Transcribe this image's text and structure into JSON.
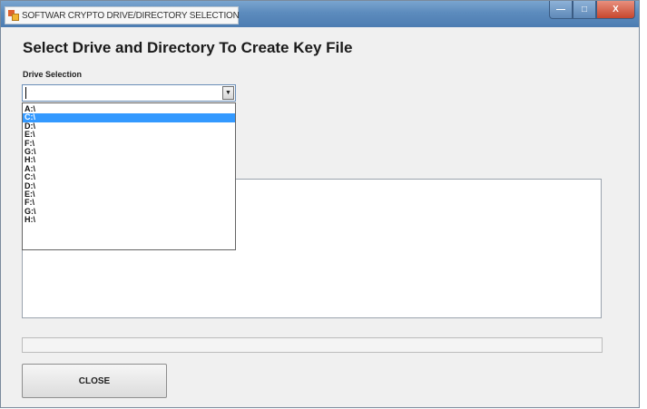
{
  "window": {
    "title": "SOFTWAR CRYPTO DRIVE/DIRECTORY SELECTION",
    "controls": {
      "minimize": "—",
      "maximize": "□",
      "close": "X"
    }
  },
  "main": {
    "heading": "Select Drive and Directory To Create Key File",
    "drive_label": "Drive Selection",
    "drive_combo": {
      "value": "",
      "arrow": "▼"
    },
    "drive_options": [
      "A:\\",
      "C:\\",
      "D:\\",
      "E:\\",
      "F:\\",
      "G:\\",
      "H:\\",
      "A:\\",
      "C:\\",
      "D:\\",
      "E:\\",
      "F:\\",
      "G:\\",
      "H:\\"
    ],
    "selected_option_index": 1,
    "close_label": "CLOSE"
  },
  "colors": {
    "selection": "#3399ff",
    "titlebar": "#5c8bbd",
    "close_control": "#c7462d"
  },
  "icons": {
    "app": "app-icon",
    "dropdown": "chevron-down-icon"
  }
}
